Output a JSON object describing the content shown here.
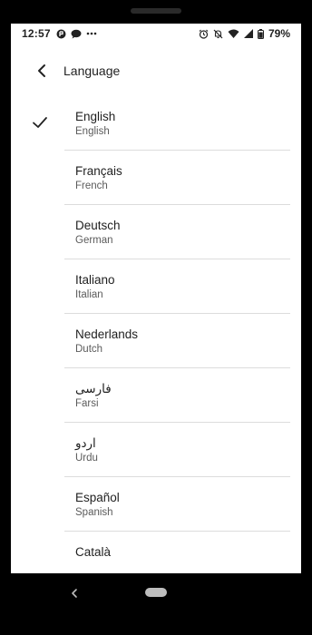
{
  "status_bar": {
    "time": "12:57",
    "battery": "79%",
    "left_icons": [
      "game-icon",
      "chat-icon",
      "more-dots-icon"
    ],
    "right_icons": [
      "alarm-icon",
      "notifications-off-icon",
      "wifi-icon",
      "signal-icon",
      "battery-icon"
    ]
  },
  "app_bar": {
    "title": "Language",
    "back_icon": "back-arrow-icon"
  },
  "languages": [
    {
      "native": "English",
      "english": "English",
      "selected": true
    },
    {
      "native": "Français",
      "english": "French",
      "selected": false
    },
    {
      "native": "Deutsch",
      "english": "German",
      "selected": false
    },
    {
      "native": "Italiano",
      "english": "Italian",
      "selected": false
    },
    {
      "native": "Nederlands",
      "english": "Dutch",
      "selected": false
    },
    {
      "native": "فارسی",
      "english": "Farsi",
      "selected": false
    },
    {
      "native": "اردو",
      "english": "Urdu",
      "selected": false
    },
    {
      "native": "Español",
      "english": "Spanish",
      "selected": false
    },
    {
      "native": "Català",
      "english": "",
      "selected": false
    }
  ],
  "nav_bar": {
    "back_icon": "nav-back-icon",
    "home_icon": "home-pill-icon"
  },
  "colors": {
    "frame": "#000000",
    "screen_bg": "#ffffff",
    "divider": "#dcdcdc",
    "text_primary": "#1f1f1f",
    "text_secondary": "#5b5b5b"
  }
}
